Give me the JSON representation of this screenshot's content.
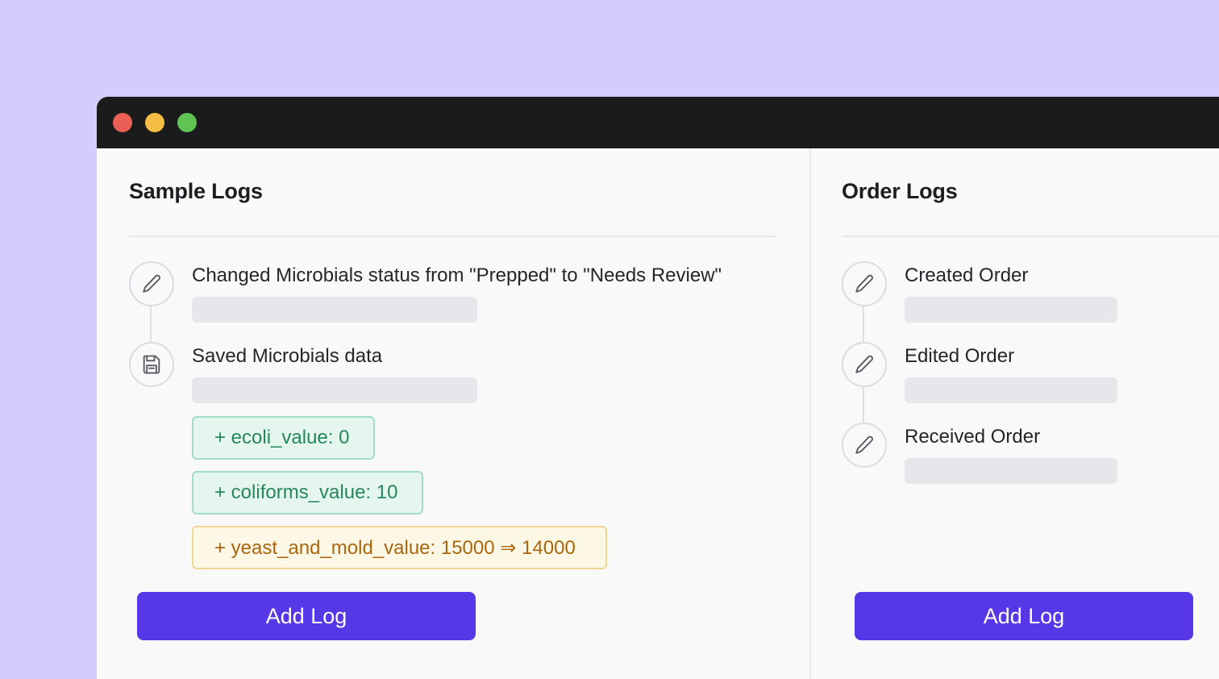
{
  "window": {
    "controls": [
      "close",
      "minimize",
      "maximize"
    ]
  },
  "sample_logs": {
    "title": "Sample Logs",
    "entries": [
      {
        "icon": "pencil-icon",
        "text": "Changed Microbials status from \"Prepped\" to \"Needs Review\""
      },
      {
        "icon": "save-icon",
        "text": "Saved Microbials data"
      }
    ],
    "changes": [
      {
        "text": "+ ecoli_value: 0",
        "type": "added"
      },
      {
        "text": "+ coliforms_value: 10",
        "type": "added"
      },
      {
        "text": "+ yeast_and_mold_value: 15000 ⇒ 14000",
        "type": "changed"
      }
    ],
    "add_button": "Add Log"
  },
  "order_logs": {
    "title": "Order Logs",
    "entries": [
      {
        "icon": "pencil-icon",
        "text": "Created Order"
      },
      {
        "icon": "pencil-icon",
        "text": "Edited Order"
      },
      {
        "icon": "pencil-icon",
        "text": "Received Order"
      }
    ],
    "add_button": "Add Log"
  },
  "colors": {
    "background": "#d4ccfa",
    "titlebar": "#1b1b1b",
    "accent": "#5638e6",
    "added_bg": "#e5f6ee",
    "added_text": "#26875f",
    "changed_bg": "#fdf8e6",
    "changed_text": "#a9660e"
  }
}
